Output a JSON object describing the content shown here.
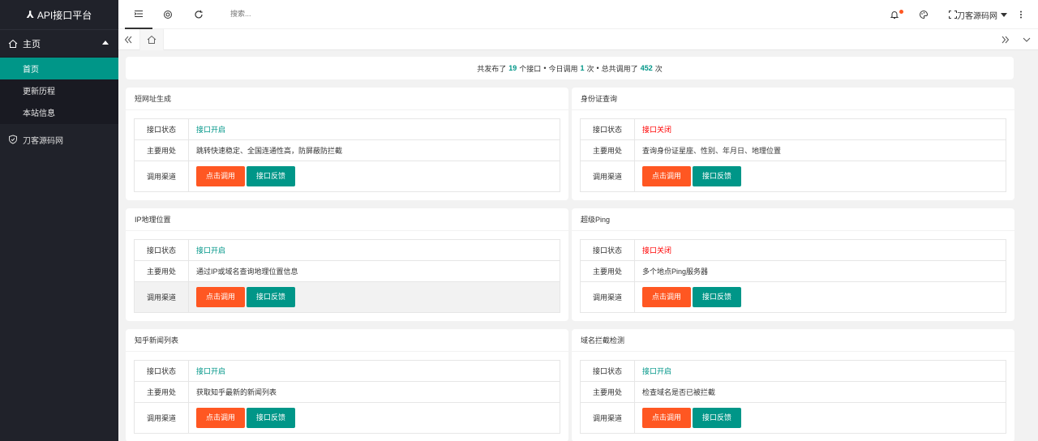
{
  "app": {
    "title": "API接口平台",
    "logo_mark": "⅄"
  },
  "sidebar": {
    "group_main": "主页",
    "items": [
      {
        "label": "首页",
        "active": true
      },
      {
        "label": "更新历程",
        "active": false
      },
      {
        "label": "本站信息",
        "active": false
      }
    ],
    "group_site": "刀客源码网"
  },
  "header": {
    "search_placeholder": "搜索...",
    "user": "刀客源码网"
  },
  "summary": {
    "p1": "共发布了",
    "n1": "19",
    "p2": "个接口",
    "sep1": "•",
    "p3": "今日调用",
    "n2": "1",
    "p4": "次",
    "sep2": "•",
    "p5": "总共调用了",
    "n3": "452",
    "p6": "次"
  },
  "labels": {
    "status": "接口状态",
    "usage": "主要用处",
    "channel": "调用渠道",
    "call": "点击调用",
    "feedback": "接口反馈"
  },
  "cards": [
    {
      "title": "短网址生成",
      "status": "接口开启",
      "usage": "跳转快速稳定、全国连通性高，防屏蔽防拦截"
    },
    {
      "title": "身份证查询",
      "status": "接口关闭",
      "usage": "查询身份证星座、性别、年月日、地理位置"
    },
    {
      "title": "IP地理位置",
      "status": "接口开启",
      "usage": "通过IP或域名查询地理位置信息"
    },
    {
      "title": "超级Ping",
      "status": "接口关闭",
      "usage": "多个地点Ping服务器"
    },
    {
      "title": "知乎新闻列表",
      "status": "接口开启",
      "usage": "获取知乎最新的新闻列表"
    },
    {
      "title": "域名拦截检测",
      "status": "接口开启",
      "usage": "检查域名是否已被拦截"
    }
  ],
  "colors": {
    "accent": "#009688",
    "danger": "#ff5722",
    "off": "#ff0000",
    "sidebar": "#20222a"
  }
}
